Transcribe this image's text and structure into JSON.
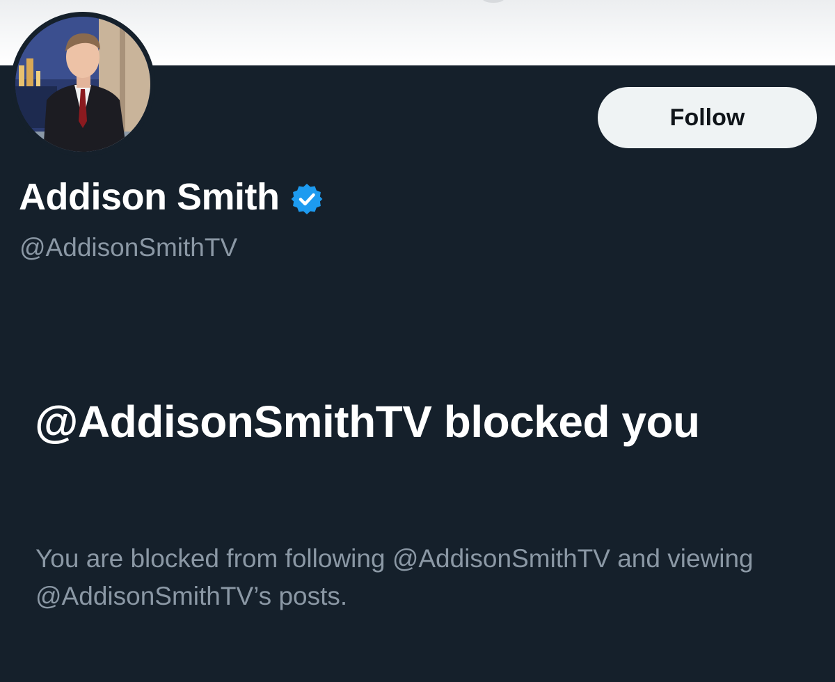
{
  "profile": {
    "display_name": "Addison Smith",
    "handle": "@AddisonSmithTV",
    "verified": true,
    "avatar_icon": "profile-photo",
    "follow_label": "Follow"
  },
  "blocked": {
    "title": "@AddisonSmithTV blocked you",
    "description": "You are blocked from following @AddisonSmithTV and viewing @AddisonSmithTV’s posts."
  },
  "colors": {
    "background": "#15202b",
    "primary_text": "#ffffff",
    "secondary_text": "#8b98a5",
    "verified_blue": "#1d9bf0",
    "button_bg": "#eff3f4"
  }
}
